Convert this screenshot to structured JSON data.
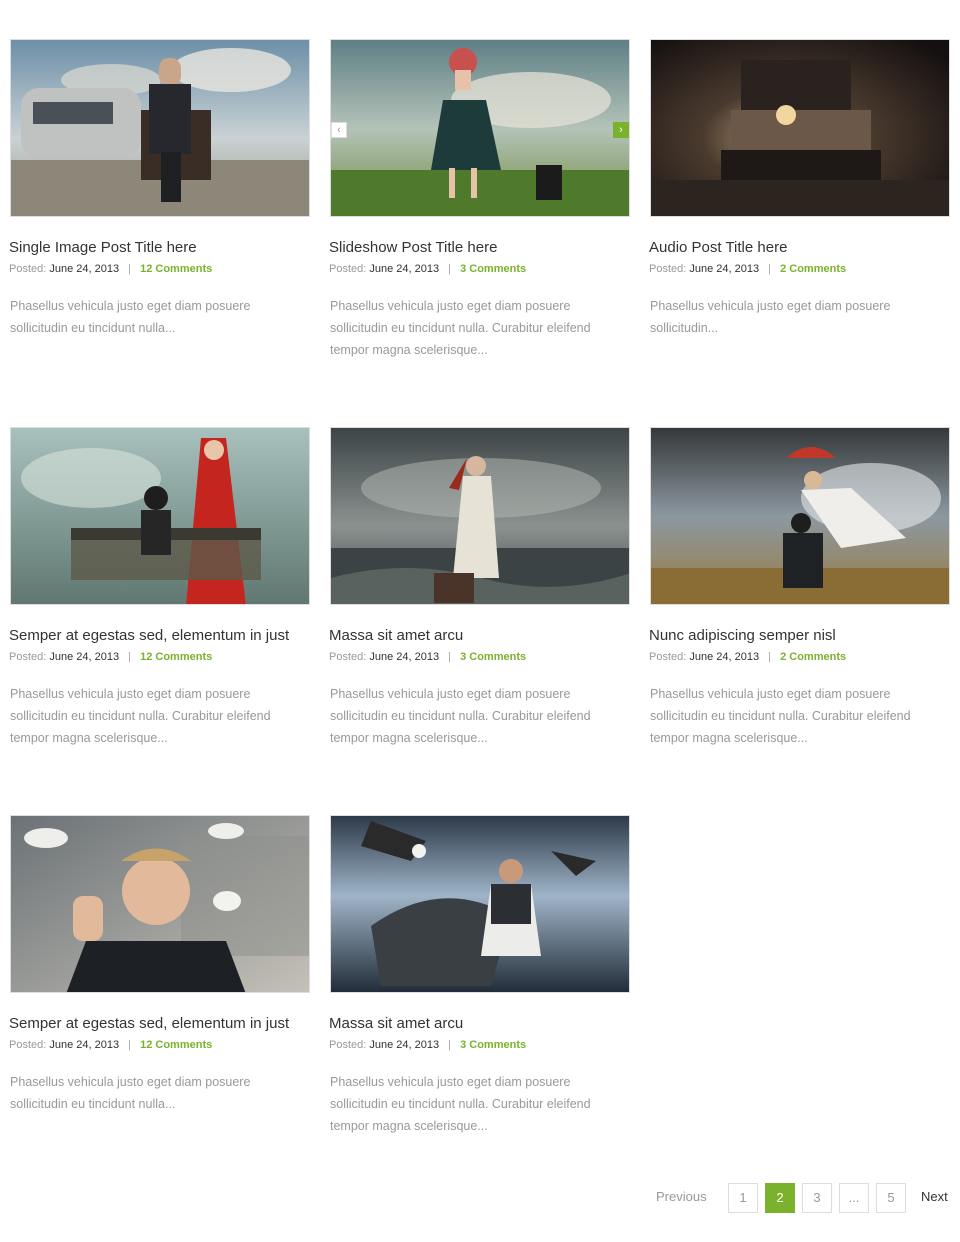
{
  "posts": [
    {
      "title": "Single Image Post Title here",
      "posted_label": "Posted:",
      "date": "June 24, 2013",
      "sep": "|",
      "comments": "12 Comments",
      "excerpt": "Phasellus vehicula justo eget diam posuere sollicitudin eu tincidunt nulla...",
      "image": "man-on-throne-with-caravan"
    },
    {
      "title": "Slideshow Post Title here",
      "posted_label": "Posted:",
      "date": "June 24, 2013",
      "sep": "|",
      "comments": "3 Comments",
      "excerpt": "Phasellus vehicula justo eget diam posuere sollicitudin eu tincidunt nulla. Curabitur eleifend tempor magna scelerisque...",
      "image": "woman-with-roses-and-telephone"
    },
    {
      "title": "Audio Post Title here",
      "posted_label": "Posted:",
      "date": "June 24, 2013",
      "sep": "|",
      "comments": "2 Comments",
      "excerpt": "Phasellus vehicula justo eget diam posuere sollicitudin...",
      "image": "dark-room-bed-scene"
    },
    {
      "title": "Semper at egestas sed, elementum in just",
      "posted_label": "Posted:",
      "date": "June 24, 2013",
      "sep": "|",
      "comments": "12 Comments",
      "excerpt": "Phasellus vehicula justo eget diam posuere sollicitudin eu tincidunt nulla. Curabitur eleifend tempor magna scelerisque...",
      "image": "man-on-bench-red-cloak"
    },
    {
      "title": "Massa sit amet arcu",
      "posted_label": "Posted:",
      "date": "June 24, 2013",
      "sep": "|",
      "comments": "3 Comments",
      "excerpt": "Phasellus vehicula justo eget diam posuere sollicitudin eu tincidunt nulla. Curabitur eleifend tempor magna scelerisque...",
      "image": "woman-in-stormy-sea"
    },
    {
      "title": "Nunc adipiscing semper nisl",
      "posted_label": "Posted:",
      "date": "June 24, 2013",
      "sep": "|",
      "comments": "2 Comments",
      "excerpt": "Phasellus vehicula justo eget diam posuere sollicitudin eu tincidunt nulla. Curabitur eleifend tempor magna scelerisque...",
      "image": "couple-with-umbrella-field"
    },
    {
      "title": "Semper at egestas sed, elementum in just",
      "posted_label": "Posted:",
      "date": "June 24, 2013",
      "sep": "|",
      "comments": "12 Comments",
      "excerpt": "Phasellus vehicula justo eget diam posuere sollicitudin eu tincidunt nulla...",
      "image": "man-with-doves"
    },
    {
      "title": "Massa sit amet arcu",
      "posted_label": "Posted:",
      "date": "June 24, 2013",
      "sep": "|",
      "comments": "3 Comments",
      "excerpt": "Phasellus vehicula justo eget diam posuere sollicitudin eu tincidunt nulla. Curabitur eleifend tempor magna scelerisque...",
      "image": "man-with-eagles"
    }
  ],
  "slideshow": {
    "prev_icon": "chevron-left-icon",
    "next_icon": "chevron-right-icon"
  },
  "pagination": {
    "previous": "Previous",
    "pages": [
      "1",
      "2",
      "3",
      "...",
      "5"
    ],
    "current": "2",
    "next": "Next"
  },
  "colors": {
    "accent": "#7ab22e",
    "text": "#333333",
    "muted": "#999999"
  }
}
